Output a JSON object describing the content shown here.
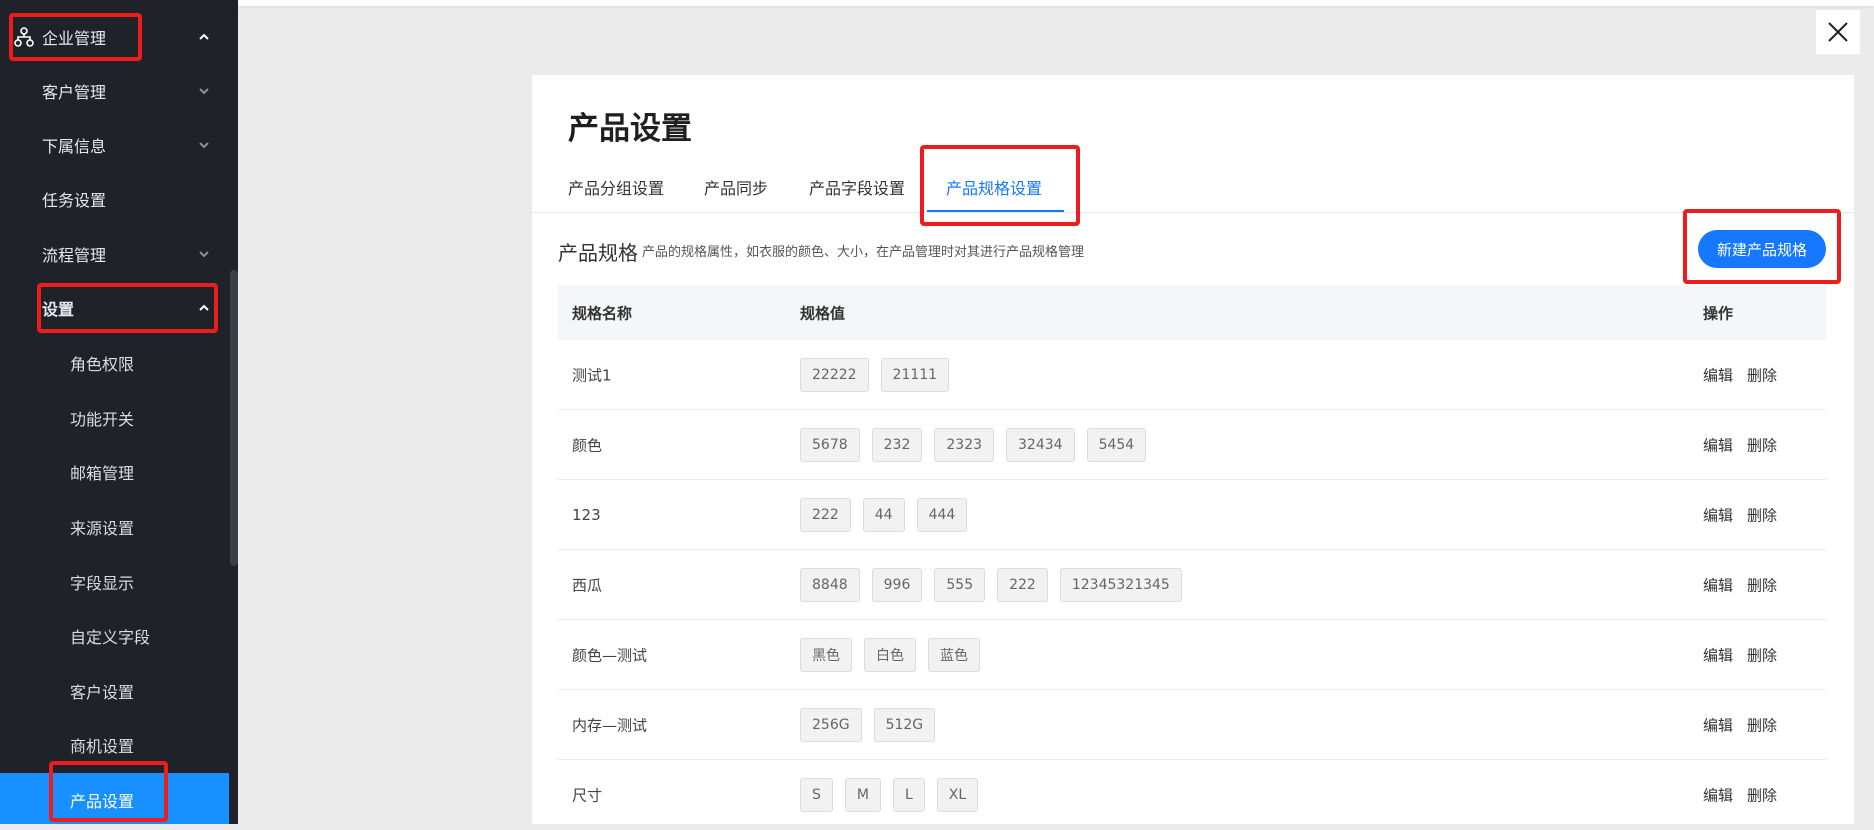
{
  "sidebar": {
    "items": [
      {
        "label": "企业管理",
        "expanded": true
      },
      {
        "label": "客户管理"
      },
      {
        "label": "下属信息"
      },
      {
        "label": "任务设置"
      },
      {
        "label": "流程管理"
      },
      {
        "label": "设置",
        "expanded": true
      },
      {
        "label": "角色权限"
      },
      {
        "label": "功能开关"
      },
      {
        "label": "邮箱管理"
      },
      {
        "label": "来源设置"
      },
      {
        "label": "字段显示"
      },
      {
        "label": "自定义字段"
      },
      {
        "label": "客户设置"
      },
      {
        "label": "商机设置"
      },
      {
        "label": "产品设置",
        "active": true
      }
    ]
  },
  "page": {
    "title": "产品设置",
    "tabs": [
      "产品分组设置",
      "产品同步",
      "产品字段设置",
      "产品规格设置"
    ],
    "active_tab": "产品规格设置",
    "section_title": "产品规格",
    "section_desc": "产品的规格属性，如衣服的颜色、大小，在产品管理时对其进行产品规格管理",
    "new_button": "新建产品规格"
  },
  "table": {
    "headers": {
      "name": "规格名称",
      "values": "规格值",
      "ops": "操作"
    },
    "rows": [
      {
        "name": "测试1",
        "values": [
          "22222",
          "21111"
        ]
      },
      {
        "name": "颜色",
        "values": [
          "5678",
          "232",
          "2323",
          "32434",
          "5454"
        ]
      },
      {
        "name": "123",
        "values": [
          "222",
          "44",
          "444"
        ]
      },
      {
        "name": "西瓜",
        "values": [
          "8848",
          "996",
          "555",
          "222",
          "12345321345"
        ]
      },
      {
        "name": "颜色—测试",
        "values": [
          "黑色",
          "白色",
          "蓝色"
        ]
      },
      {
        "name": "内存—测试",
        "values": [
          "256G",
          "512G"
        ]
      },
      {
        "name": "尺寸",
        "values": [
          "S",
          "M",
          "L",
          "XL"
        ]
      }
    ],
    "edit_label": "编辑",
    "delete_label": "删除"
  },
  "colors": {
    "sidebar_bg": "#1f2329",
    "accent": "#1677ff",
    "highlight": "#ee1c1c"
  }
}
